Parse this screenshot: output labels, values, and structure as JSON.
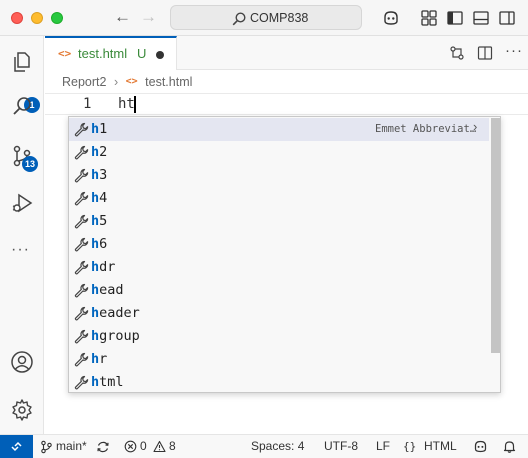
{
  "titlebar": {
    "search_text": "COMP838",
    "back_label": "←",
    "forward_label": "→"
  },
  "activity_bar": {
    "explorer_badge": "1",
    "source_control_badge": "13",
    "more_label": "···"
  },
  "tab": {
    "label": "test.html",
    "status": "U"
  },
  "breadcrumb": {
    "folder": "Report2",
    "file": "test.html"
  },
  "editor": {
    "line_number": "1",
    "text": "ht"
  },
  "suggestions": {
    "detail": "Emmet Abbreviat…",
    "items": [
      {
        "match": "h",
        "rest": "1"
      },
      {
        "match": "h",
        "rest": "2"
      },
      {
        "match": "h",
        "rest": "3"
      },
      {
        "match": "h",
        "rest": "4"
      },
      {
        "match": "h",
        "rest": "5"
      },
      {
        "match": "h",
        "rest": "6"
      },
      {
        "match": "h",
        "rest": "dr"
      },
      {
        "match": "h",
        "rest": "ead"
      },
      {
        "match": "h",
        "rest": "eader"
      },
      {
        "match": "h",
        "rest": "group"
      },
      {
        "match": "h",
        "rest": "r"
      },
      {
        "match": "h",
        "rest": "tml"
      }
    ]
  },
  "statusbar": {
    "branch": "main*",
    "errors": "0",
    "warnings": "8",
    "spaces": "Spaces: 4",
    "encoding": "UTF-8",
    "eol": "LF",
    "language": "HTML"
  },
  "colors": {
    "accent": "#005fb8",
    "match": "#0066bf",
    "tab_label": "#3a8a3a",
    "html_icon": "#e37933"
  }
}
